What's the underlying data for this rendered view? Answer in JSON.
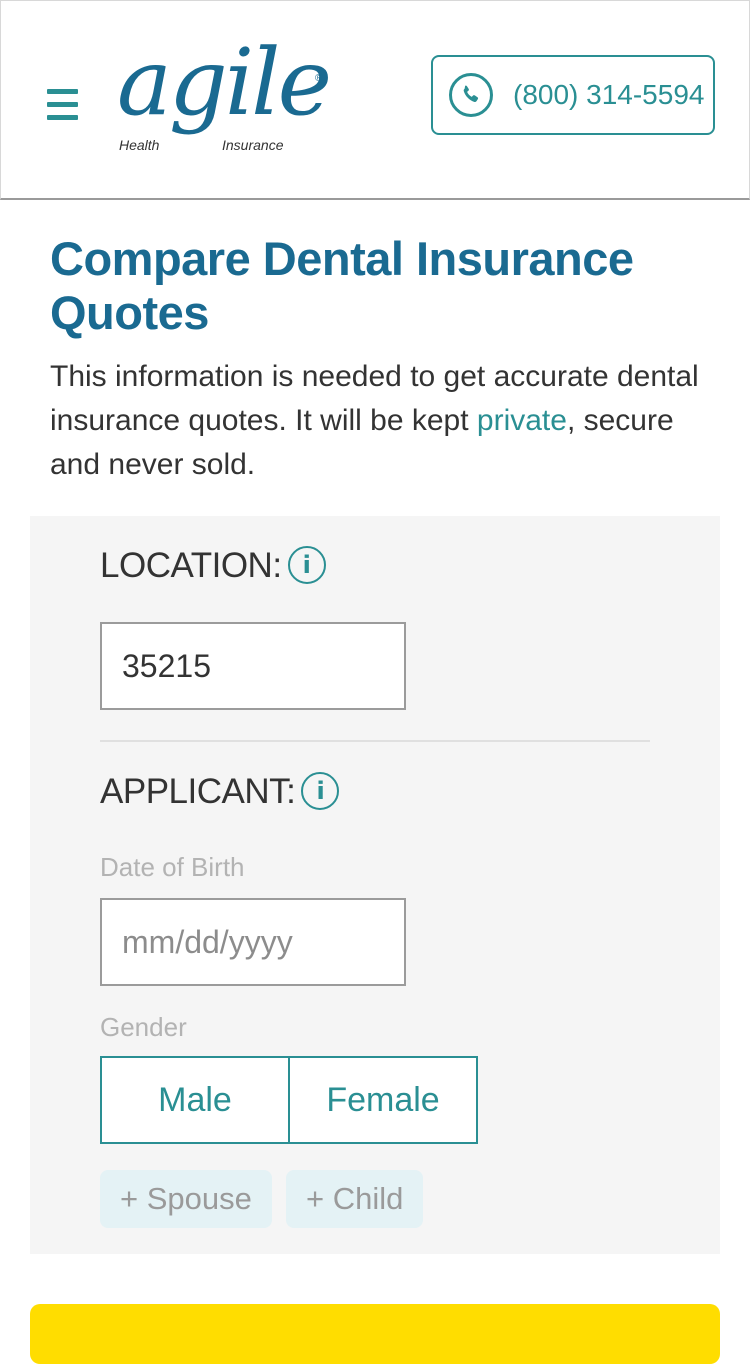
{
  "header": {
    "logo": {
      "word": "agile",
      "registered": "®",
      "line1": "Health",
      "line2": "Insurance"
    },
    "phone": "(800) 314-5594"
  },
  "main": {
    "title": "Compare Dental Insurance Quotes",
    "intro_before": "This information is needed to get accurate dental insurance quotes. It will be kept ",
    "intro_link": "private",
    "intro_after": ", secure and never sold."
  },
  "form": {
    "location_label": "LOCATION:",
    "zip_value": "35215",
    "applicant_label": "APPLICANT:",
    "dob_label": "Date of Birth",
    "dob_placeholder": "mm/dd/yyyy",
    "gender_label": "Gender",
    "gender_options": [
      "Male",
      "Female"
    ],
    "add_spouse": "+ Spouse",
    "add_child": "+ Child",
    "info_glyph": "i"
  },
  "colors": {
    "brand_blue": "#1a6a91",
    "teal": "#2a8f93",
    "cta_yellow": "#ffdd00",
    "panel_bg": "#f5f5f5"
  },
  "icons": {
    "menu": "hamburger-menu-icon",
    "phone": "phone-icon",
    "info": "info-icon"
  }
}
